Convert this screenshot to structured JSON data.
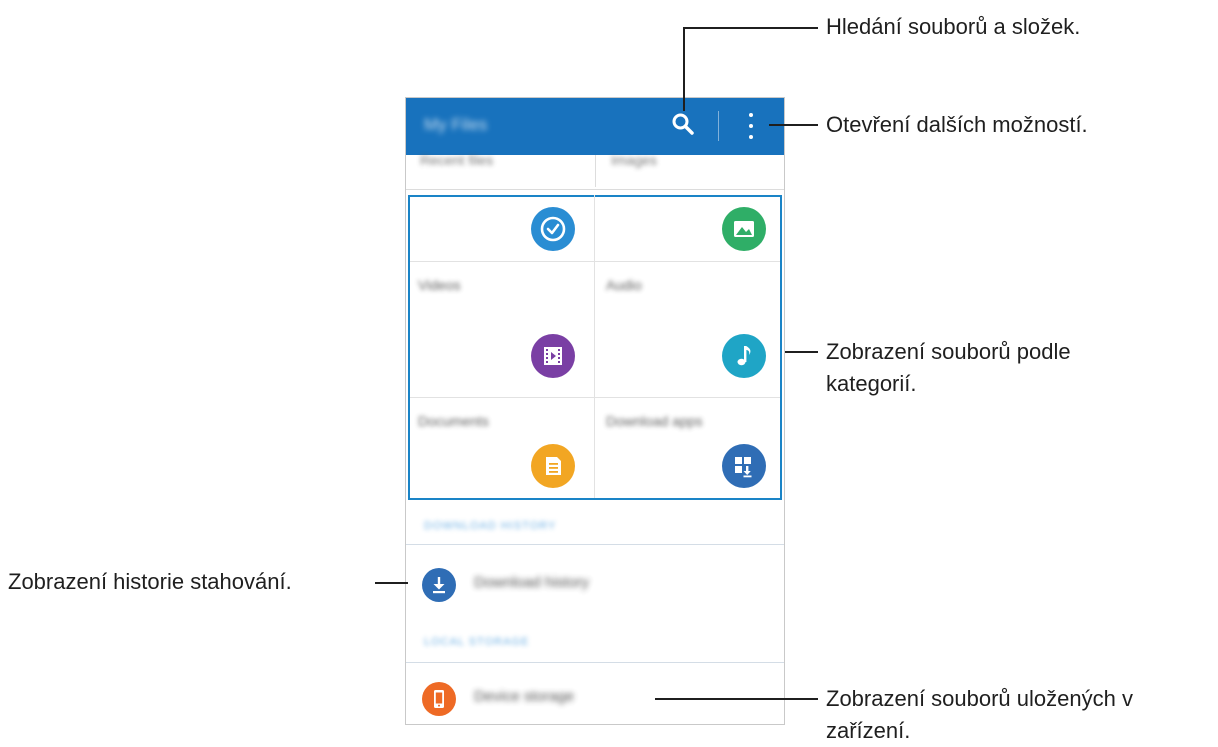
{
  "annotations": {
    "search": "Hledání souborů a složek.",
    "more": "Otevření dalších možností.",
    "categories_line1": "Zobrazení souborů podle",
    "categories_line2": "kategorií.",
    "history": "Zobrazení historie stahování.",
    "storage_line1": "Zobrazení souborů uložených v",
    "storage_line2": "zařízení."
  },
  "app": {
    "title": "My Files",
    "tabs": [
      "Recent files",
      "Images"
    ],
    "categories": [
      {
        "label": "",
        "icon": "clock-check-icon",
        "color": "#2a8dd3"
      },
      {
        "label": "",
        "icon": "image-icon",
        "color": "#2fae67"
      },
      {
        "label": "Videos",
        "icon": "video-icon",
        "color": "#7a3fa4"
      },
      {
        "label": "Audio",
        "icon": "music-note-icon",
        "color": "#1fa5c6"
      },
      {
        "label": "Documents",
        "icon": "document-icon",
        "color": "#f2a623"
      },
      {
        "label": "Download apps",
        "icon": "app-download-icon",
        "color": "#2f6db5"
      }
    ],
    "download_section_header": "DOWNLOAD HISTORY",
    "download_item": {
      "label": "Download history",
      "icon": "download-icon",
      "color": "#2f6db5"
    },
    "storage_section_header": "LOCAL STORAGE",
    "storage_item": {
      "label": "Device storage",
      "icon": "phone-icon",
      "color": "#ee6a25"
    }
  }
}
